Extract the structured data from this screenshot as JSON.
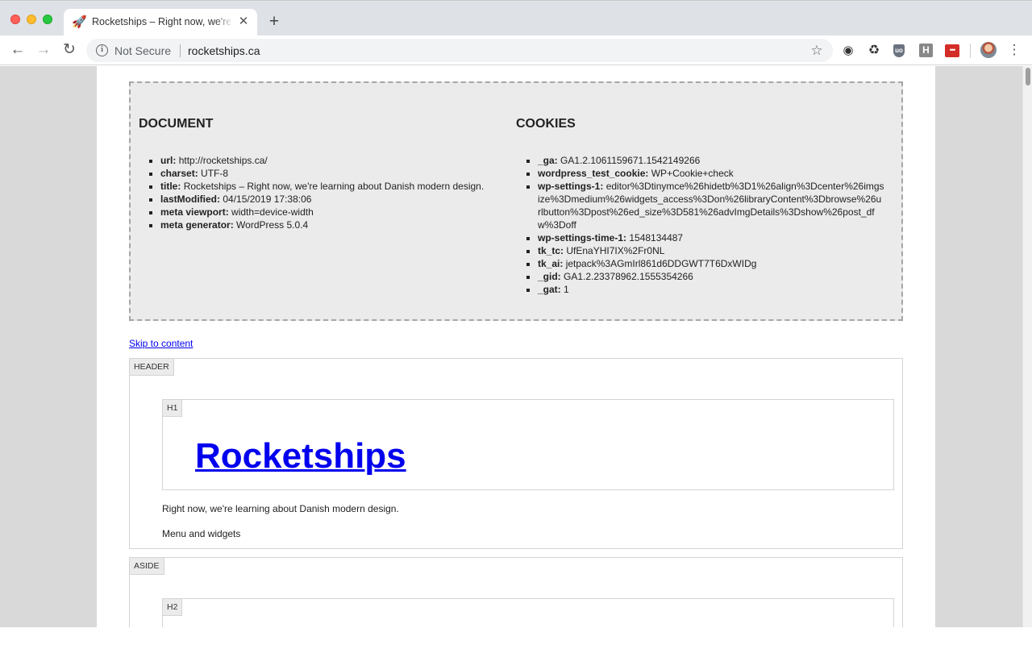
{
  "browser": {
    "tab_title": "Rocketships – Right now, we're learning about Danish modern design.",
    "new_tab_glyph": "+",
    "security_label": "Not Secure",
    "url": "rocketships.ca",
    "lastpass_glyph": "•••",
    "h_ext_glyph": "H"
  },
  "debug": {
    "document": {
      "heading": "DOCUMENT",
      "items": [
        {
          "key": "url:",
          "value": "http://rocketships.ca/"
        },
        {
          "key": "charset:",
          "value": "UTF-8"
        },
        {
          "key": "title:",
          "value": "Rocketships – Right now, we're learning about Danish modern design."
        },
        {
          "key": "lastModified:",
          "value": "04/15/2019 17:38:06"
        },
        {
          "key": "meta viewport:",
          "value": "width=device-width"
        },
        {
          "key": "meta generator:",
          "value": "WordPress 5.0.4"
        }
      ]
    },
    "cookies": {
      "heading": "COOKIES",
      "items": [
        {
          "key": "_ga:",
          "value": "GA1.2.1061159671.1542149266"
        },
        {
          "key": "wordpress_test_cookie:",
          "value": "WP+Cookie+check"
        },
        {
          "key": "wp-settings-1:",
          "value": "editor%3Dtinymce%26hidetb%3D1%26align%3Dcenter%26imgsize%3Dmedium%26widgets_access%3Don%26libraryContent%3Dbrowse%26urlbutton%3Dpost%26ed_size%3D581%26advImgDetails%3Dshow%26post_dfw%3Doff"
        },
        {
          "key": "wp-settings-time-1:",
          "value": "1548134487"
        },
        {
          "key": "tk_tc:",
          "value": "UfEnaYHI7IX%2Fr0NL"
        },
        {
          "key": "tk_ai:",
          "value": "jetpack%3AGmIrl861d6DDGWT7T6DxWIDg"
        },
        {
          "key": "_gid:",
          "value": "GA1.2.23378962.1555354266"
        },
        {
          "key": "_gat:",
          "value": "1"
        }
      ]
    }
  },
  "page": {
    "skip_link": "Skip to content",
    "header_tag": "HEADER",
    "h1_tag": "H1",
    "site_title": "Rocketships",
    "tagline": "Right now, we're learning about Danish modern design.",
    "menu_widgets": "Menu and widgets",
    "aside_tag": "ASIDE",
    "h2_tag": "H2"
  }
}
